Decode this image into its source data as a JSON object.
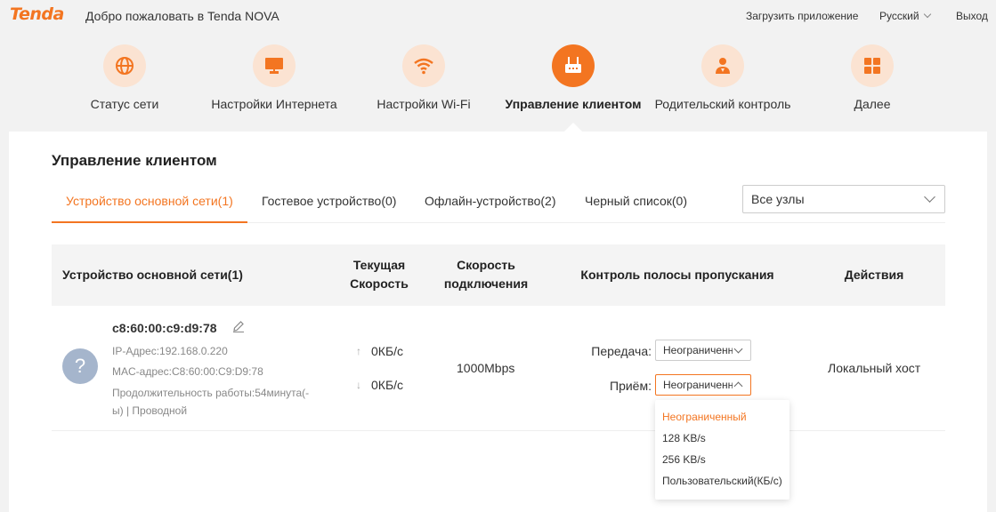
{
  "header": {
    "logo": "Tenda",
    "welcome": "Добро пожаловать в Tenda NOVA",
    "download_app": "Загрузить приложение",
    "language": "Русский",
    "logout": "Выход"
  },
  "nav": [
    {
      "label": "Статус сети",
      "icon": "globe-icon"
    },
    {
      "label": "Настройки Интернета",
      "icon": "monitor-icon"
    },
    {
      "label": "Настройки Wi-Fi",
      "icon": "wifi-icon"
    },
    {
      "label": "Управление клиентом",
      "icon": "router-icon",
      "active": true
    },
    {
      "label": "Родительский контроль",
      "icon": "parent-icon"
    },
    {
      "label": "Далее",
      "icon": "grid-icon"
    }
  ],
  "page": {
    "title": "Управление клиентом",
    "tabs": [
      "Устройство основной сети(1)",
      "Гостевое устройство(0)",
      "Офлайн-устройство(2)",
      "Черный список(0)"
    ],
    "filter": "Все узлы"
  },
  "table": {
    "headers": {
      "device": "Устройство основной сети(1)",
      "current_speed_1": "Текущая",
      "current_speed_2": "Скорость",
      "link_speed_1": "Скорость",
      "link_speed_2": "подключения",
      "bandwidth": "Контроль полосы пропускания",
      "actions": "Действия"
    },
    "row": {
      "mac": "c8:60:00:c9:d9:78",
      "ip": "IP-Адрес:192.168.0.220",
      "mac_addr": "MAC-адрес:C8:60:00:C9:D9:78",
      "uptime_1": "Продолжительность работы:54минута(-",
      "uptime_2": "ы) | Проводной",
      "avatar": "?",
      "up_arrow": "↑",
      "down_arrow": "↓",
      "upload": "0КБ/с",
      "download": "0КБ/с",
      "link_speed": "1000Mbps",
      "tx_label": "Передача:",
      "tx_value": "Неограниченный",
      "rx_label": "Приём:",
      "rx_value": "Неограниченный",
      "action": "Локальный хост"
    }
  },
  "dropdown": {
    "options": [
      "Неограниченный",
      "128 KB/s",
      "256 KB/s",
      "Пользовательский(КБ/с)"
    ],
    "selected_index": 0
  },
  "colors": {
    "accent": "#f37521",
    "accent_light": "#fbe3d2"
  }
}
